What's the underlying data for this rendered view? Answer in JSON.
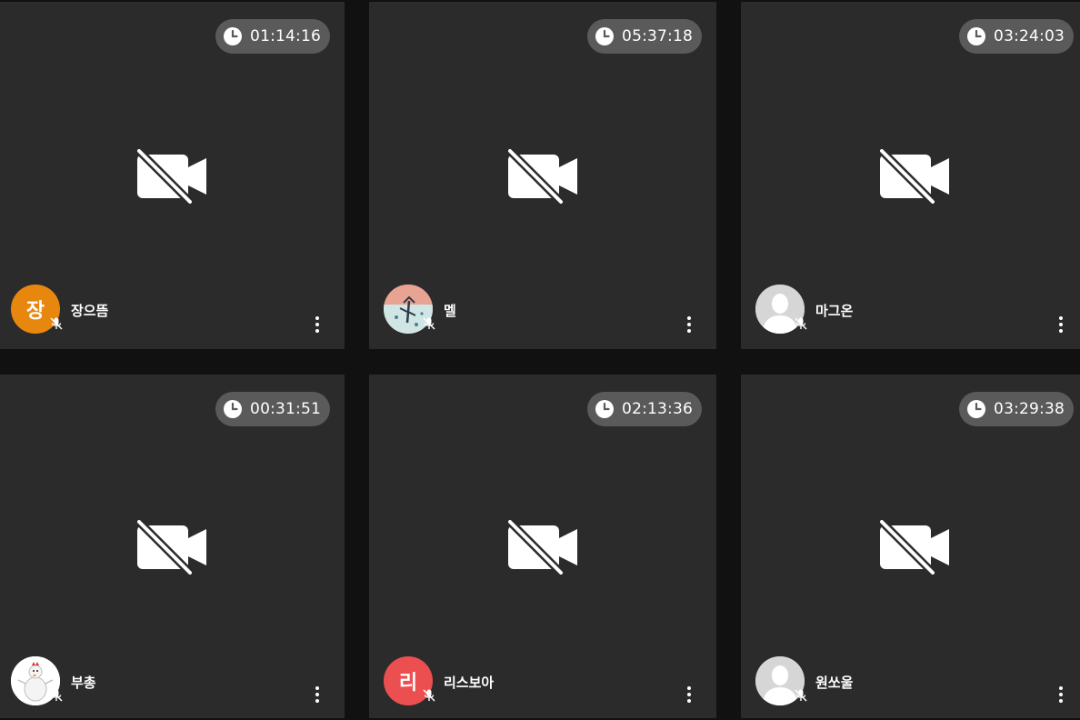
{
  "participants": [
    {
      "name": "장으뜸",
      "timer": "01:14:16",
      "avatar_type": "initial",
      "avatar_text": "장",
      "avatar_color": "#e8870e",
      "mic": "muted",
      "camera": "off"
    },
    {
      "name": "멜",
      "timer": "05:37:18",
      "avatar_type": "photo",
      "avatar_text": "",
      "avatar_color": "#e9a392",
      "mic": "muted",
      "camera": "off"
    },
    {
      "name": "마그온",
      "timer": "03:24:03",
      "avatar_type": "default",
      "avatar_text": "",
      "avatar_color": "#cfcfcf",
      "mic": "muted",
      "camera": "off"
    },
    {
      "name": "부총",
      "timer": "00:31:51",
      "avatar_type": "photo",
      "avatar_text": "",
      "avatar_color": "#ffffff",
      "mic": "muted",
      "camera": "off"
    },
    {
      "name": "리스보아",
      "timer": "02:13:36",
      "avatar_type": "initial",
      "avatar_text": "리",
      "avatar_color": "#ec4f4f",
      "mic": "muted",
      "camera": "off"
    },
    {
      "name": "원쏘울",
      "timer": "03:29:38",
      "avatar_type": "default",
      "avatar_text": "",
      "avatar_color": "#cfcfcf",
      "mic": "muted",
      "camera": "off"
    }
  ],
  "colors": {
    "background": "#111111",
    "tile": "#2b2b2b",
    "timer_pill": "#5a5a5a",
    "text": "#ffffff"
  },
  "icons": {
    "timer": "clock-icon",
    "camera": "videocam-off-icon",
    "mic": "mic-off-icon",
    "menu": "more-vert-icon"
  }
}
